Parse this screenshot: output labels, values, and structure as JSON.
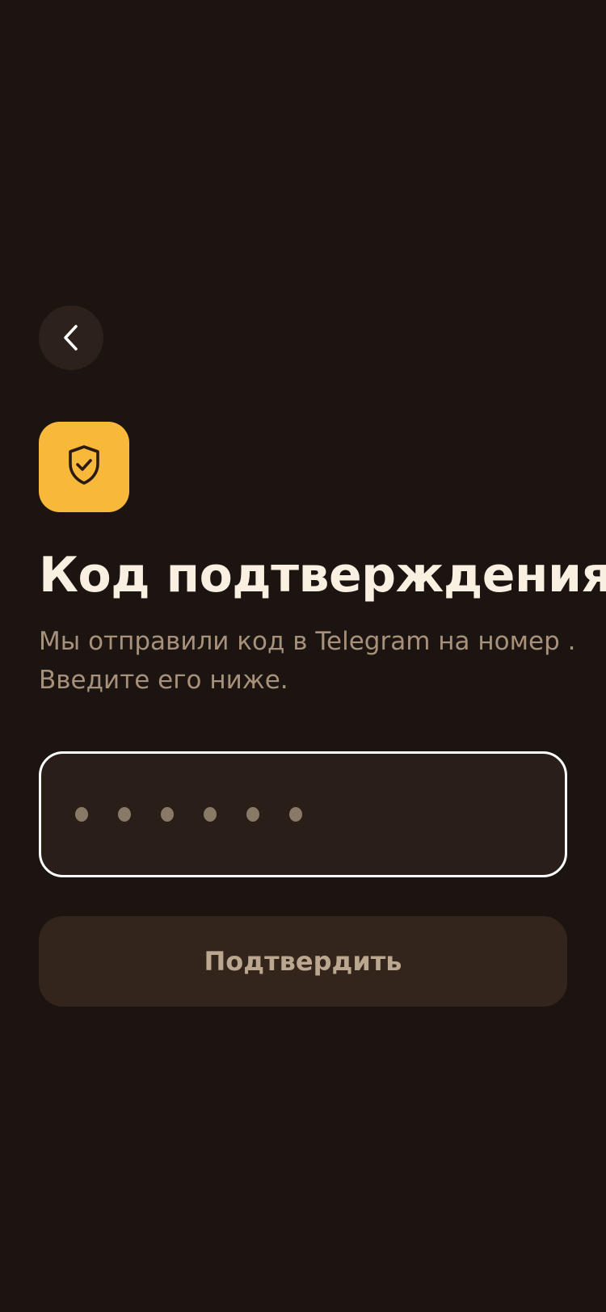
{
  "header": {
    "back_icon": "chevron-left-icon"
  },
  "badge": {
    "icon": "shield-check-icon",
    "color": "#f8b83a"
  },
  "title": "Код подтверждения",
  "subtitle": "Мы отправили код в Telegram на номер . Введите его ниже.",
  "code_input": {
    "length": 6,
    "placeholder_symbol": "•",
    "value": ""
  },
  "confirm_button": {
    "label": "Подтвердить"
  },
  "colors": {
    "background": "#1c1410",
    "accent": "#f8b83a",
    "title": "#faf0e2",
    "subtitle": "#a8917a",
    "button_bg": "#33251b",
    "button_text": "#bba690"
  }
}
